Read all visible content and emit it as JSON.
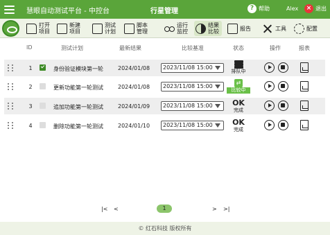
{
  "header": {
    "app_title": "慧眼自动测试平台 - 中控台",
    "center_title": "行星管理",
    "help_label": "帮助",
    "user_name": "Alex",
    "exit_label": "退出"
  },
  "toolbar": {
    "items": [
      {
        "label": "打开项目",
        "icon": "folder-open-icon"
      },
      {
        "label": "新建项目",
        "icon": "new-file-icon"
      },
      {
        "label": "测试计划",
        "icon": "clipboard-icon"
      },
      {
        "label": "脚本管理",
        "icon": "script-icon"
      },
      {
        "label": "运行监控",
        "icon": "glasses-icon"
      },
      {
        "label": "结果比较",
        "icon": "contrast-icon",
        "active": true
      },
      {
        "label": "报告",
        "icon": "report-icon"
      },
      {
        "label": "工具",
        "icon": "tools-icon"
      },
      {
        "label": "配置",
        "icon": "gear-icon"
      }
    ]
  },
  "table": {
    "columns": [
      "ID",
      "测试计划",
      "最新结果",
      "比较基准",
      "状态",
      "操作",
      "报表"
    ],
    "rows": [
      {
        "id": "1",
        "checked": true,
        "plan": "身份验证模块第一轮",
        "latest": "2024/01/08",
        "baseline": "2023/11/08 15:00",
        "status": "排队中",
        "status_icon": "stack-icon"
      },
      {
        "id": "2",
        "checked": false,
        "plan": "更新功能第一轮测试",
        "latest": "2024/01/08",
        "baseline": "2023/11/08 15:00",
        "status": "比较中",
        "status_icon": "compare-icon"
      },
      {
        "id": "3",
        "checked": false,
        "plan": "追加功能第一轮测试",
        "latest": "2024/01/09",
        "baseline": "2023/11/08 15:00",
        "status_glyph": "OK",
        "status": "完成"
      },
      {
        "id": "4",
        "checked": false,
        "plan": "删除功能第一轮测试",
        "latest": "2024/01/10",
        "baseline": "2023/11/08 15:00",
        "status_glyph": "OK",
        "status": "完成"
      }
    ]
  },
  "pagination": {
    "first": "|<",
    "prev": "<",
    "current": "1",
    "next": ">",
    "last": ">|"
  },
  "footer": {
    "copyright": "© 红石科技 版权所有"
  },
  "colors": {
    "brand_green": "#5aa53a",
    "toolbar_bg": "#eef3e6",
    "row_alt": "#eeeeee",
    "status_green": "#6ac048"
  }
}
